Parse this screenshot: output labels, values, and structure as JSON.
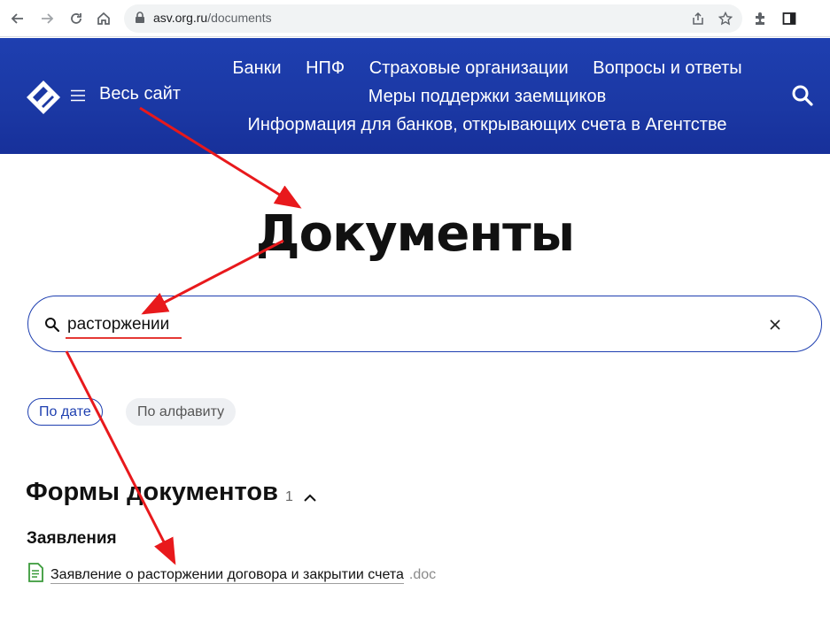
{
  "browser": {
    "url_host": "asv.org.ru",
    "url_path": "/documents",
    "icons": [
      "back-icon",
      "forward-icon",
      "reload-icon",
      "home-icon",
      "lock-icon",
      "share-icon",
      "star-icon",
      "extensions-icon",
      "side-panel-icon"
    ]
  },
  "header": {
    "all_site_label": "Весь сайт",
    "nav_items": [
      "Банки",
      "НПФ",
      "Страховые организации",
      "Вопросы и ответы",
      "Меры поддержки заемщиков",
      "Информация для банков, открывающих счета в Агентстве"
    ],
    "colors": {
      "header_bg": "#1b38a4",
      "accent": "#1e3fb0"
    }
  },
  "page": {
    "title": "Документы",
    "search_value": "расторжении",
    "sort": {
      "by_date": "По дате",
      "by_alpha": "По алфавиту"
    },
    "section": {
      "title": "Формы документов",
      "count": "1",
      "subsection": "Заявления",
      "documents": [
        {
          "name": "Заявление о расторжении договора и закрытии счета",
          "ext": ".doc"
        }
      ]
    }
  },
  "annotations": {
    "arrow_color": "#e8191c",
    "underline_color": "#e53935"
  }
}
